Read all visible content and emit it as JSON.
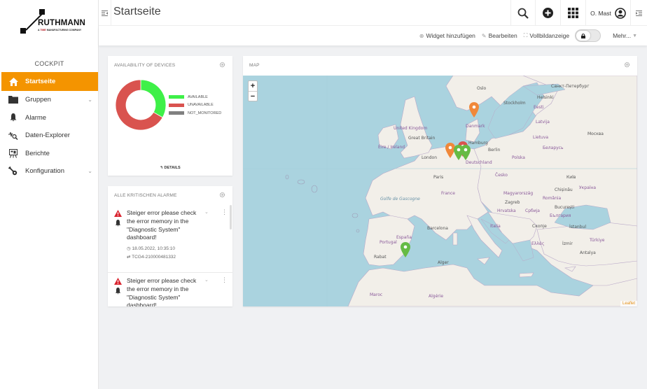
{
  "brand": {
    "name": "RUTHMANN",
    "tagline_prefix": "A",
    "tagline_brand": "TIME",
    "tagline_suffix": "MANUFACTURING COMPANY"
  },
  "sidebar": {
    "section": "COCKPIT",
    "items": [
      {
        "label": "Startseite",
        "icon": "home-icon",
        "active": true,
        "expandable": false
      },
      {
        "label": "Gruppen",
        "icon": "folder-icon",
        "active": false,
        "expandable": true
      },
      {
        "label": "Alarme",
        "icon": "bell-icon",
        "active": false,
        "expandable": false
      },
      {
        "label": "Daten-Explorer",
        "icon": "data-explorer-icon",
        "active": false,
        "expandable": false
      },
      {
        "label": "Berichte",
        "icon": "report-icon",
        "active": false,
        "expandable": false
      },
      {
        "label": "Konfiguration",
        "icon": "configuration-icon",
        "active": false,
        "expandable": true
      }
    ],
    "chevron": "⌄"
  },
  "header": {
    "title": "Startseite",
    "user": "O. Mast",
    "icons": [
      "search-icon",
      "add-icon",
      "app-grid-icon",
      "user-icon",
      "right-drawer-icon"
    ]
  },
  "toolbar": {
    "add_widget": "Widget hinzufügen",
    "edit": "Bearbeiten",
    "fullscreen": "Vollbildanzeige",
    "more": "Mehr...",
    "locked": true
  },
  "availability": {
    "title": "AVAILABILITY OF DEVICES",
    "details": "DETAILS",
    "chart_data": {
      "type": "pie",
      "variant": "donut",
      "title": "AVAILABILITY OF DEVICES",
      "categories": [
        "AVAILABLE",
        "UNAVAILABLE",
        "NOT_MONITORED"
      ],
      "values": [
        33.3,
        66.7,
        0
      ],
      "colors": [
        "#3ef048",
        "#d9534f",
        "#808080"
      ],
      "legend": "right"
    }
  },
  "alarms": {
    "title": "ALLE KRITISCHEN ALARME",
    "items": [
      {
        "text": "Steiger error please check the error memory in the \"Diagnostic System\" dashboard!",
        "time": "18.05.2022, 10:35:10",
        "device": "TCG4-210000481332",
        "severity": "critical"
      },
      {
        "text": "Steiger error please check the error memory in the \"Diagnostic System\" dashboard!",
        "severity": "critical"
      }
    ]
  },
  "map": {
    "title": "MAP",
    "zoom_in": "+",
    "zoom_out": "−",
    "attribution": "Leaflet",
    "labels": [
      {
        "text": "Oslo",
        "type": "city"
      },
      {
        "text": "Stockholm",
        "type": "city"
      },
      {
        "text": "Helsinki",
        "type": "city"
      },
      {
        "text": "Санкт-Петербург",
        "type": "city"
      },
      {
        "text": "Eesti",
        "type": "country"
      },
      {
        "text": "Latvija",
        "type": "country"
      },
      {
        "text": "Lietuva",
        "type": "country"
      },
      {
        "text": "Москва",
        "type": "city"
      },
      {
        "text": "Danmark",
        "type": "country"
      },
      {
        "text": "United Kingdom",
        "type": "country"
      },
      {
        "text": "Great Britain",
        "type": "region"
      },
      {
        "text": "Éire / Ireland",
        "type": "country"
      },
      {
        "text": "Hamburg",
        "type": "city"
      },
      {
        "text": "Berlin",
        "type": "city"
      },
      {
        "text": "London",
        "type": "city"
      },
      {
        "text": "Deutschland",
        "type": "country"
      },
      {
        "text": "Polska",
        "type": "country"
      },
      {
        "text": "Беларусь",
        "type": "country"
      },
      {
        "text": "Київ",
        "type": "city"
      },
      {
        "text": "Україна",
        "type": "country"
      },
      {
        "text": "Paris",
        "type": "city"
      },
      {
        "text": "France",
        "type": "country"
      },
      {
        "text": "Česko",
        "type": "country"
      },
      {
        "text": "Magyarország",
        "type": "country"
      },
      {
        "text": "Zagreb",
        "type": "city"
      },
      {
        "text": "Hrvatska",
        "type": "country"
      },
      {
        "text": "Chișinău",
        "type": "city"
      },
      {
        "text": "România",
        "type": "country"
      },
      {
        "text": "București",
        "type": "city"
      },
      {
        "text": "Србија",
        "type": "country"
      },
      {
        "text": "България",
        "type": "country"
      },
      {
        "text": "Скопје",
        "type": "city"
      },
      {
        "text": "İstanbul",
        "type": "city"
      },
      {
        "text": "Ελλάς",
        "type": "country"
      },
      {
        "text": "İzmir",
        "type": "city"
      },
      {
        "text": "Türkiye",
        "type": "country"
      },
      {
        "text": "Antalya",
        "type": "city"
      },
      {
        "text": "Italia",
        "type": "country"
      },
      {
        "text": "Barcelona",
        "type": "city"
      },
      {
        "text": "España",
        "type": "country"
      },
      {
        "text": "Portugal",
        "type": "country"
      },
      {
        "text": "Rabat",
        "type": "city"
      },
      {
        "text": "Alger",
        "type": "city"
      },
      {
        "text": "Maroc",
        "type": "country"
      },
      {
        "text": "Algérie",
        "type": "country"
      },
      {
        "text": "Golfe de Gascogne",
        "type": "water"
      }
    ],
    "markers": [
      {
        "color": "#f0883a",
        "location": "Denmark"
      },
      {
        "color": "#f0883a",
        "location": "Belgium"
      },
      {
        "color": "#d9534f",
        "location": "Netherlands"
      },
      {
        "color": "#66bb44",
        "location": "Netherlands"
      },
      {
        "color": "#66bb44",
        "location": "Netherlands"
      },
      {
        "color": "#66bb44",
        "location": "Southern Spain"
      }
    ]
  }
}
